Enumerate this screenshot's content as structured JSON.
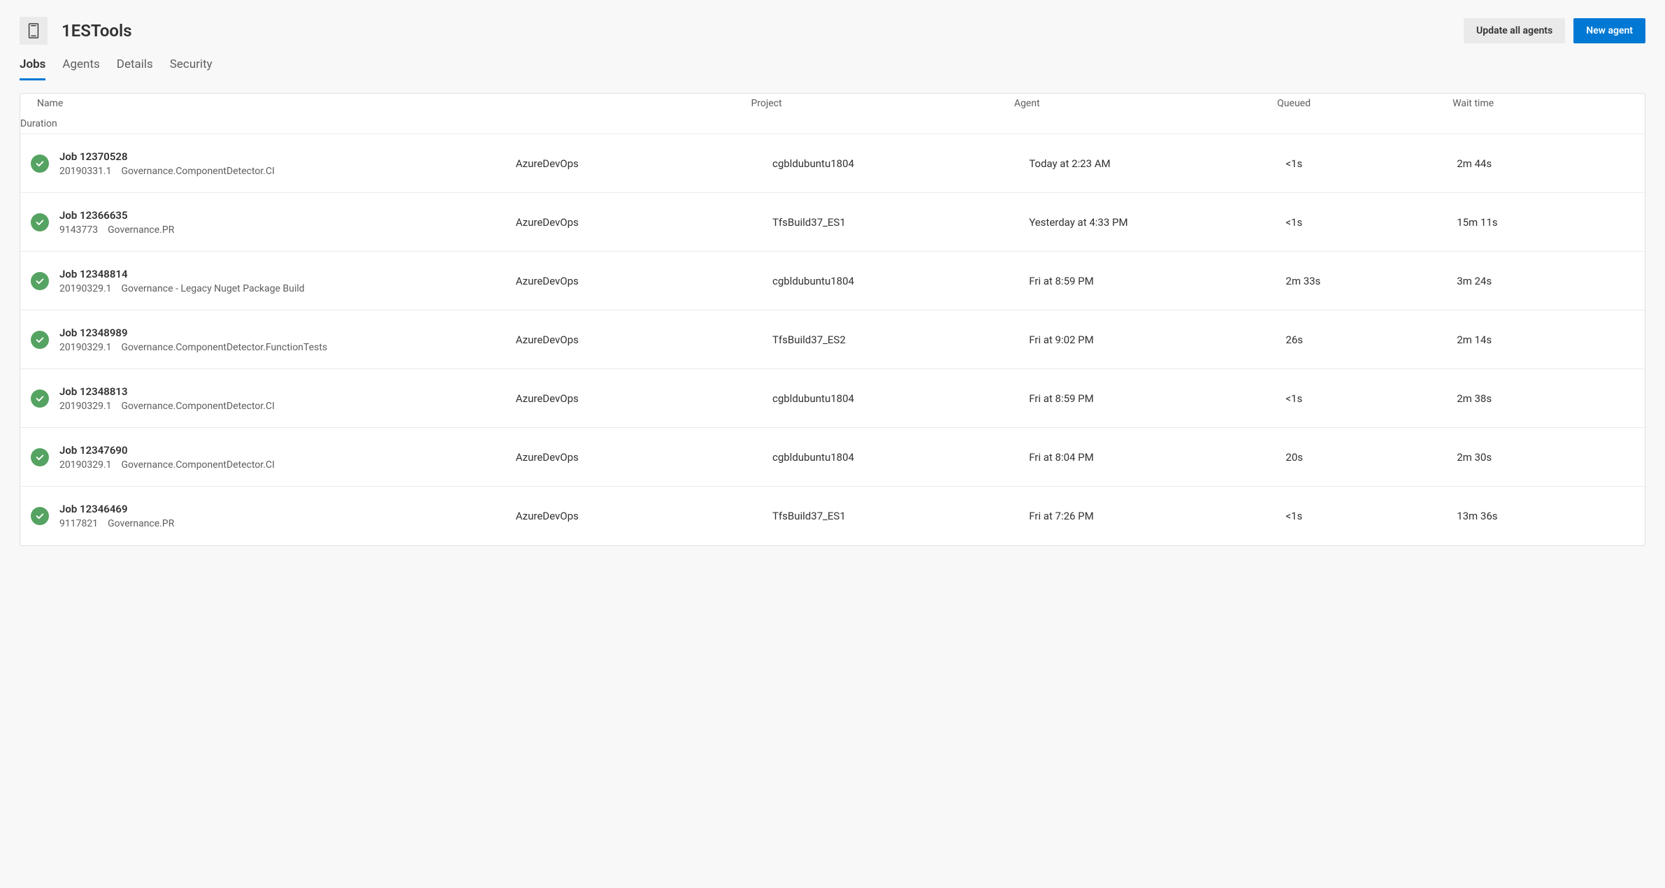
{
  "header": {
    "title": "1ESTools",
    "actions": {
      "update_all": "Update all agents",
      "new_agent": "New agent"
    }
  },
  "tabs": [
    "Jobs",
    "Agents",
    "Details",
    "Security"
  ],
  "active_tab_index": 0,
  "columns": {
    "name": "Name",
    "project": "Project",
    "agent": "Agent",
    "queued": "Queued",
    "wait": "Wait time",
    "duration": "Duration"
  },
  "jobs": [
    {
      "status": "success",
      "title": "Job 12370528",
      "build": "20190331.1",
      "definition": "Governance.ComponentDetector.CI",
      "project": "AzureDevOps",
      "agent": "cgbldubuntu1804",
      "queued": "Today at 2:23 AM",
      "wait": "<1s",
      "duration": "2m 44s"
    },
    {
      "status": "success",
      "title": "Job 12366635",
      "build": "9143773",
      "definition": "Governance.PR",
      "project": "AzureDevOps",
      "agent": "TfsBuild37_ES1",
      "queued": "Yesterday at 4:33 PM",
      "wait": "<1s",
      "duration": "15m 11s"
    },
    {
      "status": "success",
      "title": "Job 12348814",
      "build": "20190329.1",
      "definition": "Governance - Legacy Nuget Package Build",
      "project": "AzureDevOps",
      "agent": "cgbldubuntu1804",
      "queued": "Fri at 8:59 PM",
      "wait": "2m 33s",
      "duration": "3m 24s"
    },
    {
      "status": "success",
      "title": "Job 12348989",
      "build": "20190329.1",
      "definition": "Governance.ComponentDetector.FunctionTests",
      "project": "AzureDevOps",
      "agent": "TfsBuild37_ES2",
      "queued": "Fri at 9:02 PM",
      "wait": "26s",
      "duration": "2m 14s"
    },
    {
      "status": "success",
      "title": "Job 12348813",
      "build": "20190329.1",
      "definition": "Governance.ComponentDetector.CI",
      "project": "AzureDevOps",
      "agent": "cgbldubuntu1804",
      "queued": "Fri at 8:59 PM",
      "wait": "<1s",
      "duration": "2m 38s"
    },
    {
      "status": "success",
      "title": "Job 12347690",
      "build": "20190329.1",
      "definition": "Governance.ComponentDetector.CI",
      "project": "AzureDevOps",
      "agent": "cgbldubuntu1804",
      "queued": "Fri at 8:04 PM",
      "wait": "20s",
      "duration": "2m 30s"
    },
    {
      "status": "success",
      "title": "Job 12346469",
      "build": "9117821",
      "definition": "Governance.PR",
      "project": "AzureDevOps",
      "agent": "TfsBuild37_ES1",
      "queued": "Fri at 7:26 PM",
      "wait": "<1s",
      "duration": "13m 36s"
    }
  ]
}
